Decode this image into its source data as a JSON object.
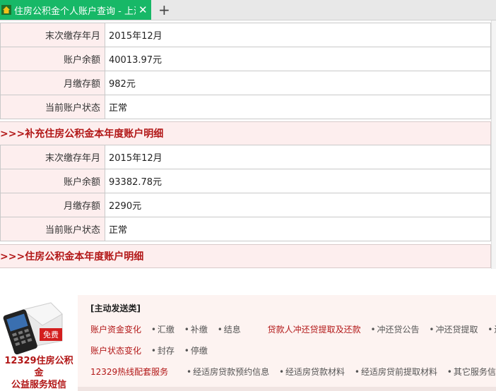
{
  "browser": {
    "tab_title": "住房公积金个人账户查询 - 上海住",
    "close_glyph": "✕",
    "new_tab_glyph": "+"
  },
  "account_basic": {
    "rows": [
      {
        "label": "末次缴存年月",
        "value": "2015年12月"
      },
      {
        "label": "账户余额",
        "value": "40013.97元"
      },
      {
        "label": "月缴存额",
        "value": "982元"
      },
      {
        "label": "当前账户状态",
        "value": "正常"
      }
    ]
  },
  "section_supplementary": ">>>补充住房公积金本年度账户明细",
  "account_supplementary": {
    "rows": [
      {
        "label": "末次缴存年月",
        "value": "2015年12月"
      },
      {
        "label": "账户余额",
        "value": "93382.78元"
      },
      {
        "label": "月缴存额",
        "value": "2290元"
      },
      {
        "label": "当前账户状态",
        "value": "正常"
      }
    ]
  },
  "section_annual": ">>>住房公积金本年度账户明细",
  "promo": {
    "badge": "免费",
    "title_line1": "12329住房公积金",
    "title_line2": "公益服务短信",
    "heading": "[主动发送类]",
    "row1": {
      "category": "账户资金变化",
      "items": [
        "汇缴",
        "补缴",
        "结息"
      ],
      "category2": "贷款人冲还贷提取及还款",
      "items2": [
        "冲还贷公告",
        "冲还贷提取",
        "还款"
      ]
    },
    "row2": {
      "category": "账户状态变化",
      "items": [
        "封存",
        "停缴"
      ]
    },
    "row3": {
      "category": "12329热线配套服务",
      "items": [
        "经适房贷款预约信息",
        "经适房贷款材料",
        "经适房贷前提取材料",
        "其它服务信息"
      ]
    }
  }
}
